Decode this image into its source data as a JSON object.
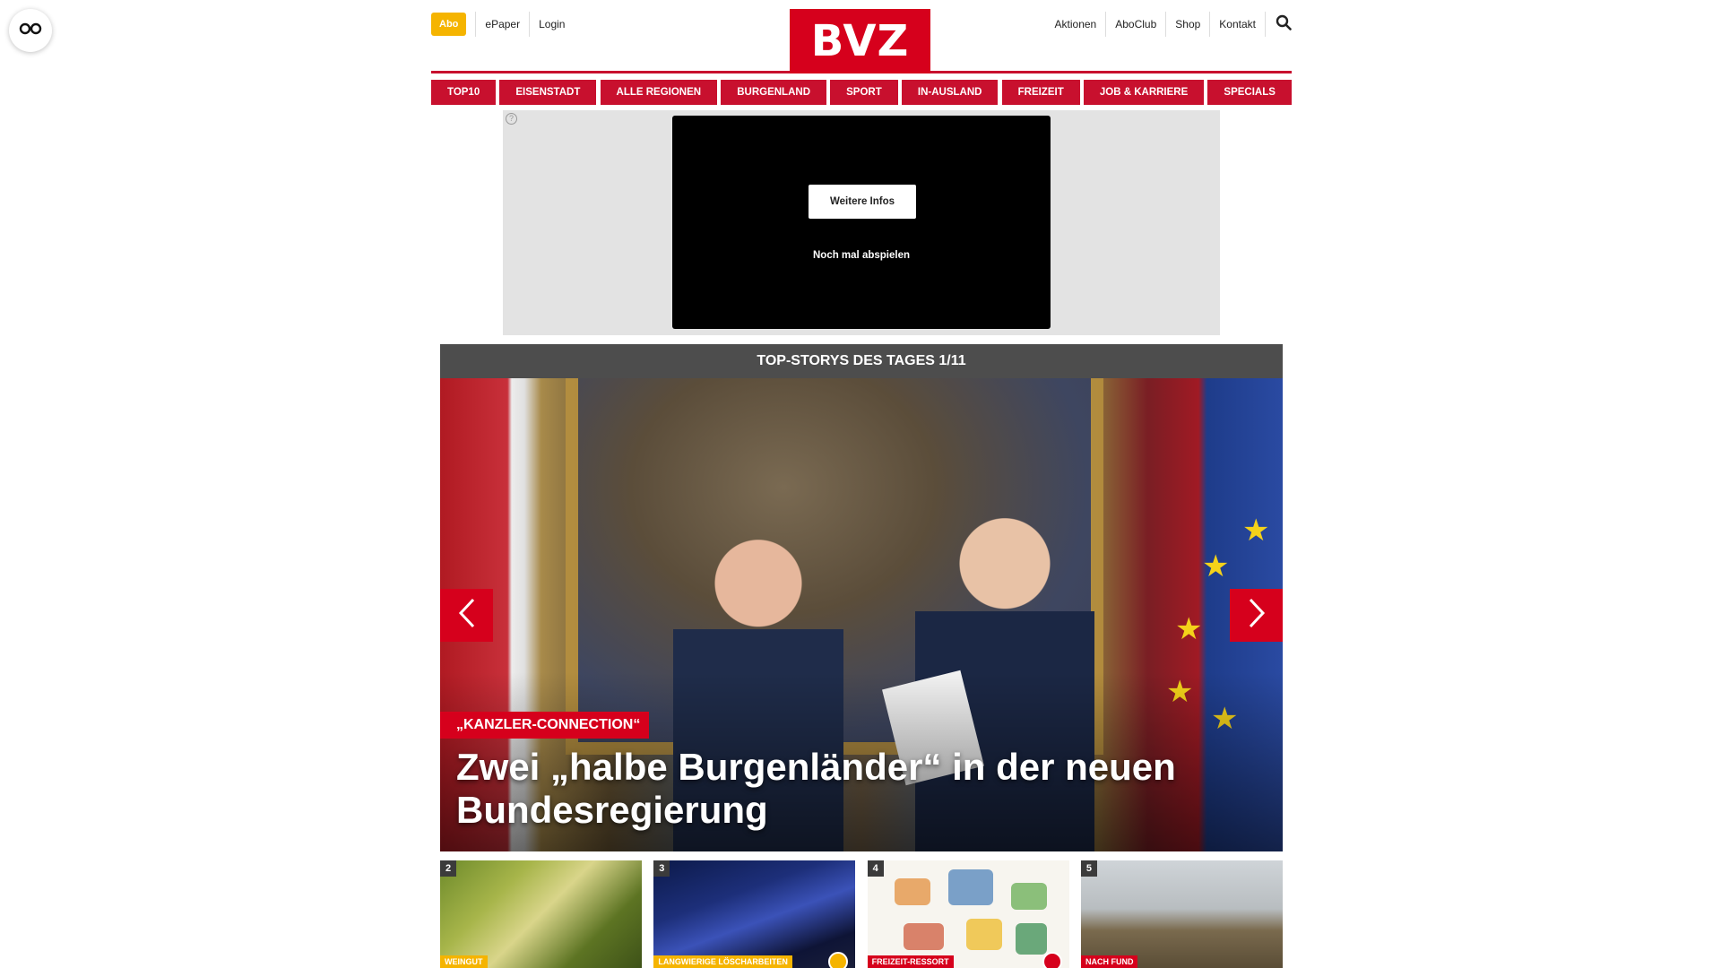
{
  "accessibility": {
    "icon": "glasses-icon"
  },
  "header": {
    "abo_label": "Abo",
    "left_links": [
      "ePaper",
      "Login"
    ],
    "logo_text": "BVZ",
    "right_links": [
      "Aktionen",
      "AboClub",
      "Shop",
      "Kontakt"
    ],
    "search_icon": "search-icon",
    "accent_color": "#d6001c",
    "abo_color": "#f5b400"
  },
  "nav": {
    "items": [
      "TOP10",
      "EISENSTADT",
      "ALLE REGIONEN",
      "BURGENLAND",
      "SPORT",
      "IN-AUSLAND",
      "FREIZEIT",
      "JOB & KARRIERE",
      "SPECIALS"
    ]
  },
  "ad": {
    "info_symbol": "?",
    "more_info_label": "Weitere Infos",
    "replay_label": "Noch mal abspielen"
  },
  "top_stories": {
    "heading": "TOP-STORYS DES TAGES 1/11",
    "hero": {
      "kicker": "„KANZLER-CONNECTION“",
      "title": "Zwei „halbe Burgenländer“ in der neuen Bundesregierung"
    },
    "thumbnails": [
      {
        "number": "2",
        "tag": "WEINGUT",
        "tag_color": "#f5b400",
        "badge": false
      },
      {
        "number": "3",
        "tag": "LANGWIERIGE LÖSCHARBEITEN",
        "tag_color": "#f5b400",
        "badge": true
      },
      {
        "number": "4",
        "tag": "FREIZEIT-RESSORT",
        "tag_color": "#d6001c",
        "badge": true
      },
      {
        "number": "5",
        "tag": "NACH FUND",
        "tag_color": "#d6001c",
        "badge": false
      }
    ]
  }
}
